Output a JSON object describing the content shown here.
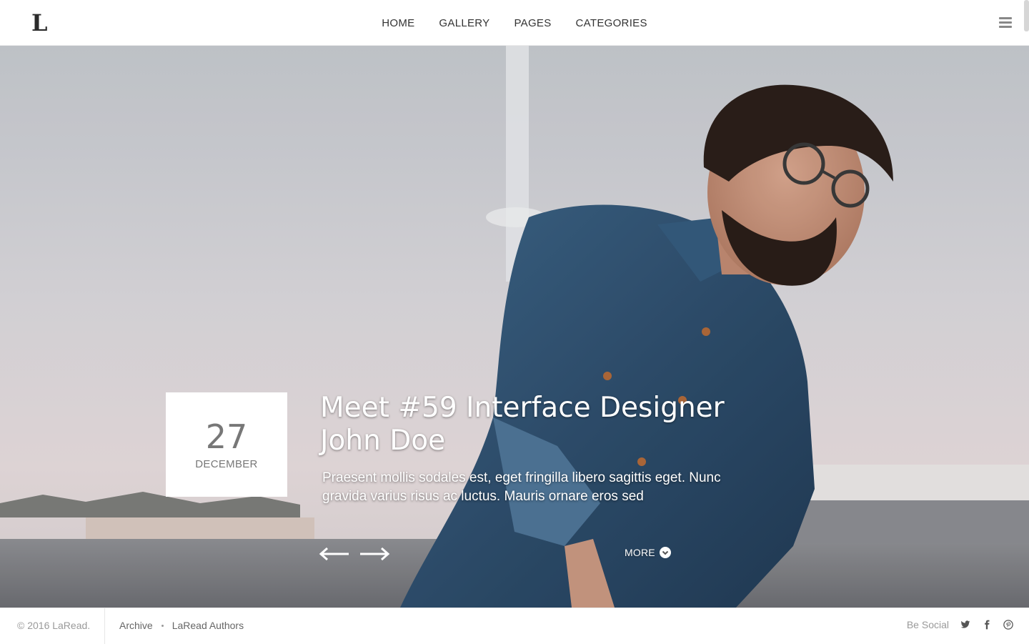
{
  "header": {
    "logo": "L",
    "nav": [
      {
        "label": "HOME"
      },
      {
        "label": "GALLERY"
      },
      {
        "label": "PAGES"
      },
      {
        "label": "CATEGORIES"
      }
    ],
    "menu_icon": "hamburger-menu-icon"
  },
  "hero": {
    "date": {
      "day": "27",
      "month": "DECEMBER"
    },
    "title": "Meet #59 Interface Designer John Doe",
    "excerpt": "Praesent mollis sodales est, eget fringilla libero sagittis eget. Nunc gravida varius risus ac luctus. Mauris ornare eros sed",
    "prev_icon": "arrow-left-icon",
    "next_icon": "arrow-right-icon",
    "more_label": "MORE",
    "more_icon": "chevron-down-circle-icon"
  },
  "footer": {
    "copyright": "© 2016 LaRead.",
    "links": [
      {
        "label": "Archive"
      },
      {
        "label": "LaRead Authors"
      }
    ],
    "social_label": "Be Social",
    "social_icons": [
      "twitter-icon",
      "facebook-icon",
      "pinterest-icon"
    ]
  },
  "colors": {
    "text_dark": "#333333",
    "text_muted": "#9a9a9a",
    "overlay_text": "#ffffff",
    "denim": "#2e4f6e"
  }
}
